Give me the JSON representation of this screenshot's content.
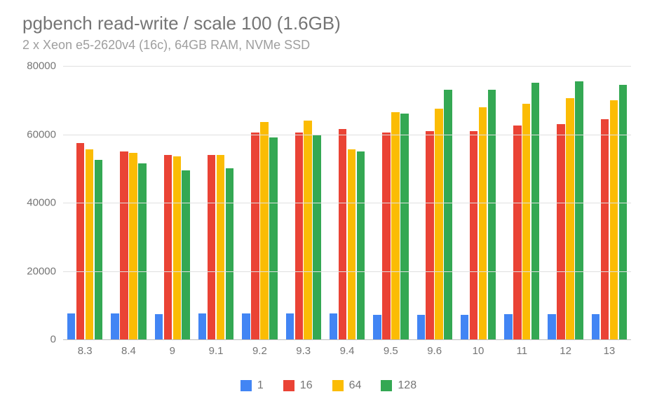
{
  "title": "pgbench read-write / scale 100 (1.6GB)",
  "subtitle": "2 x Xeon e5-2620v4 (16c), 64GB RAM, NVMe SSD",
  "colors": {
    "s1": "#4285F4",
    "s16": "#EA4335",
    "s64": "#FBBC04",
    "s128": "#34A853"
  },
  "chart_data": {
    "type": "bar",
    "xlabel": "",
    "ylabel": "",
    "ylim": [
      0,
      80000
    ],
    "yticks": [
      0,
      20000,
      40000,
      60000,
      80000
    ],
    "categories": [
      "8.3",
      "8.4",
      "9",
      "9.1",
      "9.2",
      "9.3",
      "9.4",
      "9.5",
      "9.6",
      "10",
      "11",
      "12",
      "13"
    ],
    "series": [
      {
        "name": "1",
        "color_key": "s1",
        "values": [
          7500,
          7500,
          7400,
          7500,
          7500,
          7500,
          7500,
          7200,
          7200,
          7200,
          7400,
          7400,
          7400
        ]
      },
      {
        "name": "16",
        "color_key": "s16",
        "values": [
          57500,
          55000,
          54000,
          54000,
          60500,
          60500,
          61500,
          60500,
          61000,
          61000,
          62500,
          63000,
          64500
        ]
      },
      {
        "name": "64",
        "color_key": "s64",
        "values": [
          55500,
          54500,
          53500,
          54000,
          63500,
          64000,
          55500,
          66500,
          67500,
          68000,
          69000,
          70500,
          70000
        ]
      },
      {
        "name": "128",
        "color_key": "s128",
        "values": [
          52500,
          51500,
          49500,
          50000,
          59000,
          60000,
          55000,
          66000,
          73000,
          73000,
          75000,
          75500,
          74500
        ]
      }
    ],
    "legend_position": "bottom"
  }
}
